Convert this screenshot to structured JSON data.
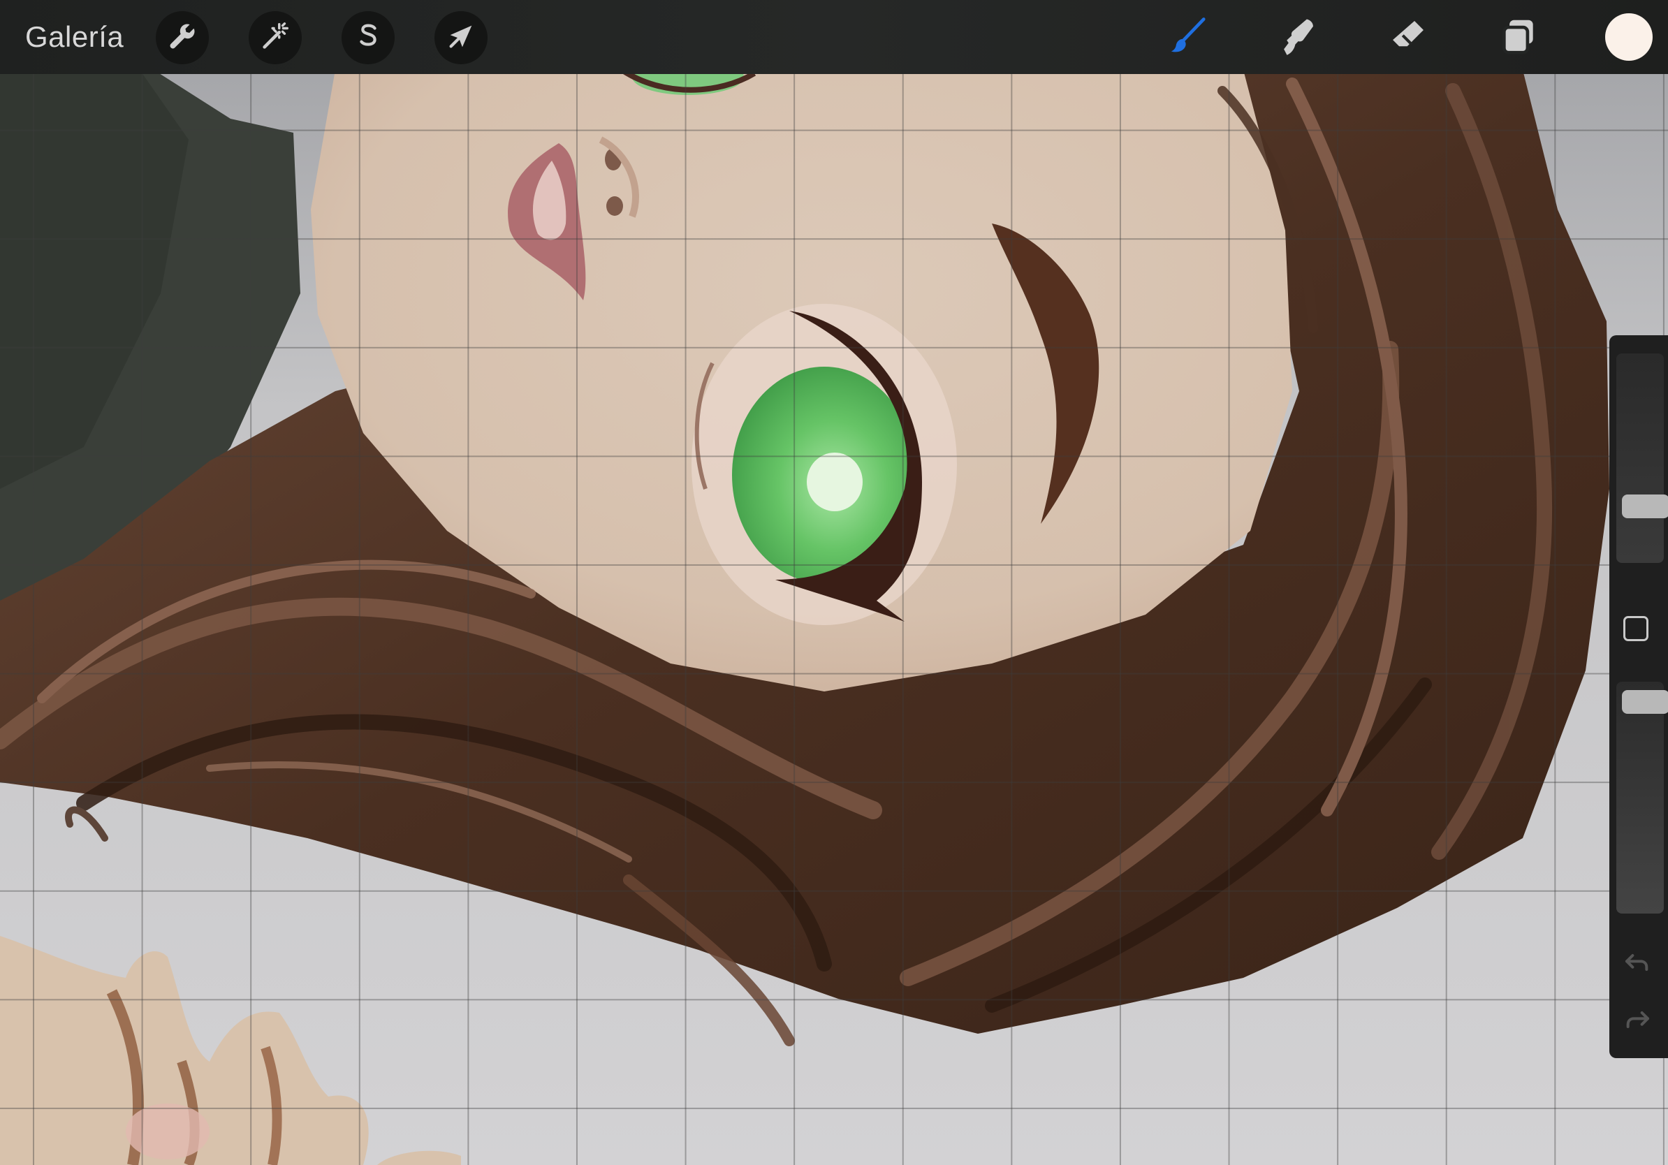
{
  "app": {
    "gallery_label": "Galería"
  },
  "toolbar": {
    "left_tools": [
      {
        "name": "actions",
        "icon": "wrench-icon"
      },
      {
        "name": "adjustments",
        "icon": "magic-wand-icon"
      },
      {
        "name": "selection",
        "icon": "selection-s-icon"
      },
      {
        "name": "transform",
        "icon": "arrow-cursor-icon"
      }
    ],
    "right_tools": [
      {
        "name": "brush",
        "icon": "brush-icon",
        "active": true
      },
      {
        "name": "smudge",
        "icon": "smudge-icon",
        "active": false
      },
      {
        "name": "eraser",
        "icon": "eraser-icon",
        "active": false
      },
      {
        "name": "layers",
        "icon": "layers-icon",
        "active": false
      }
    ],
    "current_color": "#fbf1e9"
  },
  "sidebar": {
    "brush_size_level": 0.24,
    "brush_opacity_level": 0.96,
    "modify_icon": "square-modify-icon",
    "undo_icon": "undo-icon",
    "redo_icon": "redo-icon"
  },
  "colors": {
    "toolbar_bg": "#232524",
    "accent_active": "#1f6fe0",
    "icon_gray": "#c8c8c8",
    "canvas_bg": "#d2d1d3",
    "skin": "#d8c5b4",
    "hair": "#5a3a2a",
    "eye_green": "#5fbd62",
    "clothing": "#3b403a"
  }
}
